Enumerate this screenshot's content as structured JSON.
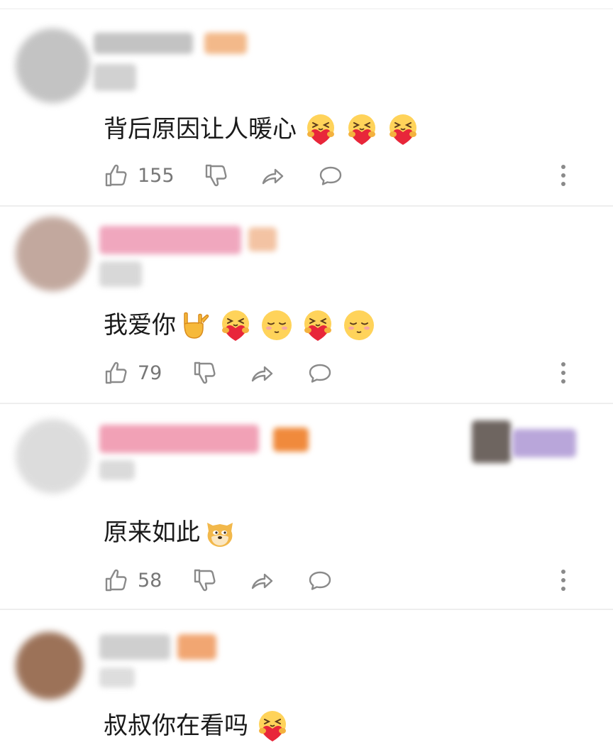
{
  "comments": [
    {
      "text": "背后原因让人暖心",
      "emojis": [
        "hug-heart-emoji",
        "hug-heart-emoji",
        "hug-heart-emoji"
      ],
      "likes": "155",
      "avatar_color": "#b9b9b9",
      "name_color": "#bdbdbd",
      "tag_color": "#f3b98a"
    },
    {
      "text": "我爱你",
      "emojis": [
        "rock-hand-emoji",
        "hug-heart-emoji",
        "shy-face-emoji",
        "hug-heart-emoji",
        "shy-face-emoji"
      ],
      "likes": "79",
      "avatar_color": "#b89a8e",
      "name_color": "#f0a7be",
      "tag_color": "#f3c3a3"
    },
    {
      "text": "原来如此",
      "emojis": [
        "doge-emoji"
      ],
      "likes": "58",
      "avatar_color": "#d7d7d7",
      "name_color": "#f1a1b6",
      "tag_color": "#f08a3c"
    },
    {
      "text": "叔叔你在看吗",
      "emojis": [
        "hug-heart-emoji"
      ],
      "likes": "",
      "avatar_color": "#8b5a3c",
      "name_color": "#c9c9c9",
      "tag_color": "#f1a672"
    }
  ],
  "colors": {
    "icon": "#8a8a8a",
    "count": "#777777",
    "divider": "#eeeeee",
    "text": "#1a1a1a"
  }
}
